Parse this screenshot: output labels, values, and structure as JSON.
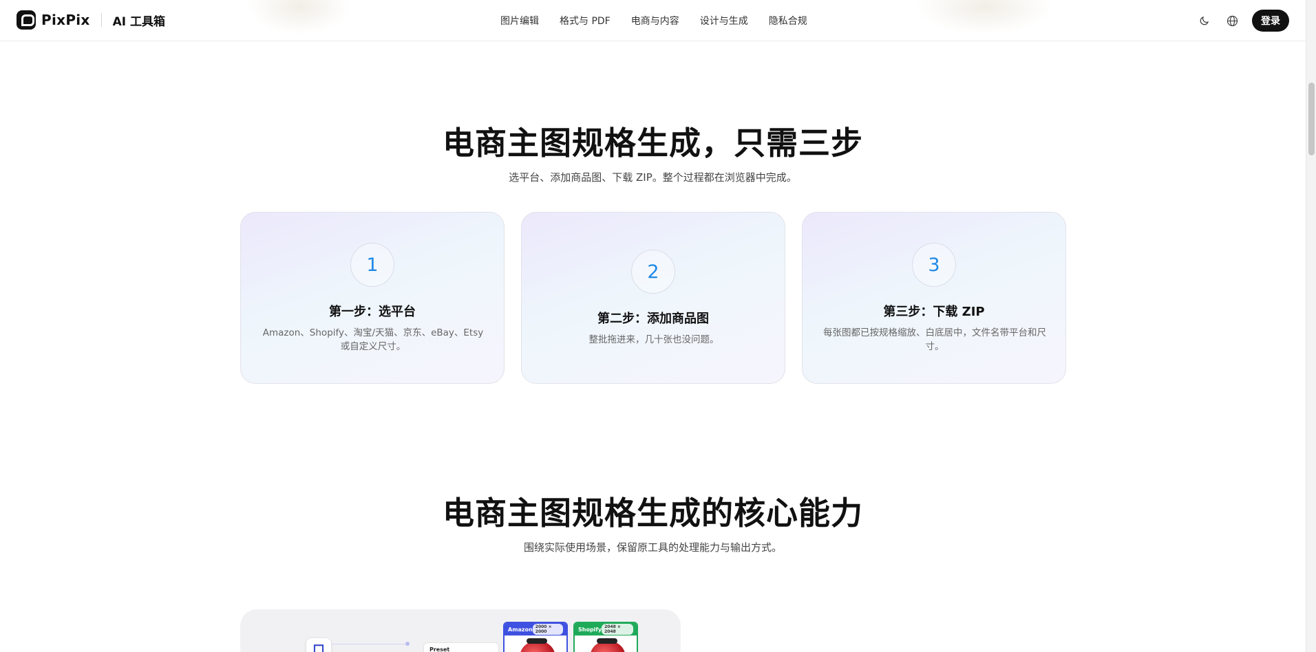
{
  "header": {
    "brand": "PixPix",
    "subtitle": "AI 工具箱",
    "nav": [
      "图片编辑",
      "格式与 PDF",
      "电商与内容",
      "设计与生成",
      "隐私合规"
    ],
    "login_label": "登录",
    "icons": [
      "moon-icon",
      "globe-icon"
    ]
  },
  "steps_section": {
    "title": "电商主图规格生成，只需三步",
    "subtitle": "选平台、添加商品图、下载 ZIP。整个过程都在浏览器中完成。",
    "steps": [
      {
        "number": "1",
        "title": "第一步：选平台",
        "desc": "Amazon、Shopify、淘宝/天猫、京东、eBay、Etsy 或自定义尺寸。"
      },
      {
        "number": "2",
        "title": "第二步：添加商品图",
        "desc": "整批拖进来，几十张也没问题。"
      },
      {
        "number": "3",
        "title": "第三步：下载 ZIP",
        "desc": "每张图都已按规格缩放、白底居中，文件名带平台和尺寸。"
      }
    ]
  },
  "features_section": {
    "title": "电商主图规格生成的核心能力",
    "subtitle": "围绕实际使用场景，保留原工具的处理能力与输出方式。"
  },
  "preview": {
    "crop_glyph": "口",
    "preset_label": "Preset",
    "platforms": [
      {
        "name": "Amazon",
        "size": "2000 × 2000",
        "color": "#3f51e0"
      },
      {
        "name": "Shopify",
        "size": "2048 × 2048",
        "color": "#1faa59"
      }
    ]
  },
  "colors": {
    "accent": "#1e88e5",
    "dark": "#111111"
  }
}
